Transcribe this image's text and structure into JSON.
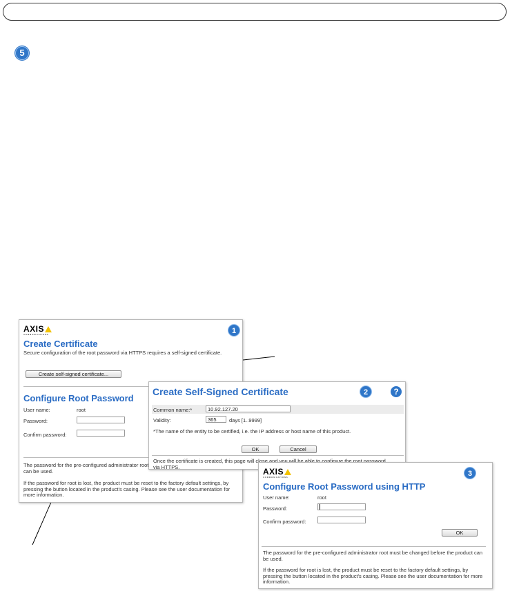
{
  "step_number": "5",
  "panel1": {
    "logo": "AXIS",
    "logo_sub": "COMMUNICATIONS",
    "badge": "1",
    "title": "Create Certificate",
    "description": "Secure configuration of the root password via HTTPS requires a self-signed certificate.",
    "create_button": "Create self-signed certificate...",
    "section_title": "Configure Root Password",
    "username_label": "User name:",
    "username_value": "root",
    "password_label": "Password:",
    "confirm_label": "Confirm password:",
    "note1": "The password for the pre-configured administrator root must be changed before the product can be used.",
    "note2": "If the password for root is lost, the product must be reset to the factory default settings, by pressing the button located in the product's casing. Please see the user documentation for more information."
  },
  "panel2": {
    "badge": "2",
    "help": "?",
    "title": "Create Self-Signed Certificate",
    "common_name_label": "Common name:*",
    "common_name_value": "10.92.127.20",
    "validity_label": "Validity:",
    "validity_value": "365",
    "validity_hint": "days [1..9999]",
    "footnote": "*The name of the entity to be certified, i.e. the IP address or host name of this product.",
    "ok": "OK",
    "cancel": "Cancel",
    "bottom_text": "Once the certificate is created, this page will close and you will be able to configure the root password via HTTPS."
  },
  "panel3": {
    "logo": "AXIS",
    "logo_sub": "COMMUNICATIONS",
    "badge": "3",
    "title": "Configure Root Password using HTTP",
    "username_label": "User name:",
    "username_value": "root",
    "password_label": "Password:",
    "confirm_label": "Confirm password:",
    "ok": "OK",
    "note1": "The password for the pre-configured administrator root must be changed before the product can be used.",
    "note2": "If the password for root is lost, the product must be reset to the factory default settings, by pressing the button located in the product's casing. Please see the user documentation for more information."
  },
  "colors": {
    "accent": "#2a6cc4",
    "badge": "#2f76c8",
    "logo_triangle": "#f2c200"
  }
}
